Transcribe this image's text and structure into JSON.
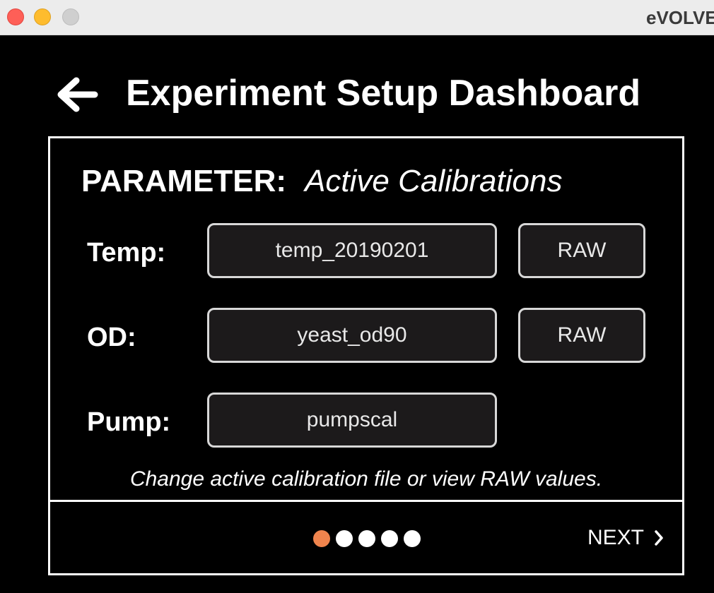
{
  "window": {
    "title": "eVOLVER"
  },
  "header": {
    "title": "Experiment Setup Dashboard",
    "back_icon": "arrow-left-icon"
  },
  "panel": {
    "parameter_label": "PARAMETER:",
    "parameter_value": "Active Calibrations",
    "rows": [
      {
        "label": "Temp:",
        "file": "temp_20190201",
        "raw": "RAW"
      },
      {
        "label": "OD:",
        "file": "yeast_od90",
        "raw": "RAW"
      },
      {
        "label": "Pump:",
        "file": "pumpscal"
      }
    ],
    "hint": "Change active calibration file or view RAW values."
  },
  "footer": {
    "pagination": {
      "total": 5,
      "active": 1
    },
    "next_label": "NEXT",
    "next_icon": "chevron-right-icon"
  },
  "colors": {
    "background": "#000000",
    "accent_dot": "#f0844d",
    "button_fill": "#1c1a1b",
    "button_border": "#d8d8d8"
  }
}
